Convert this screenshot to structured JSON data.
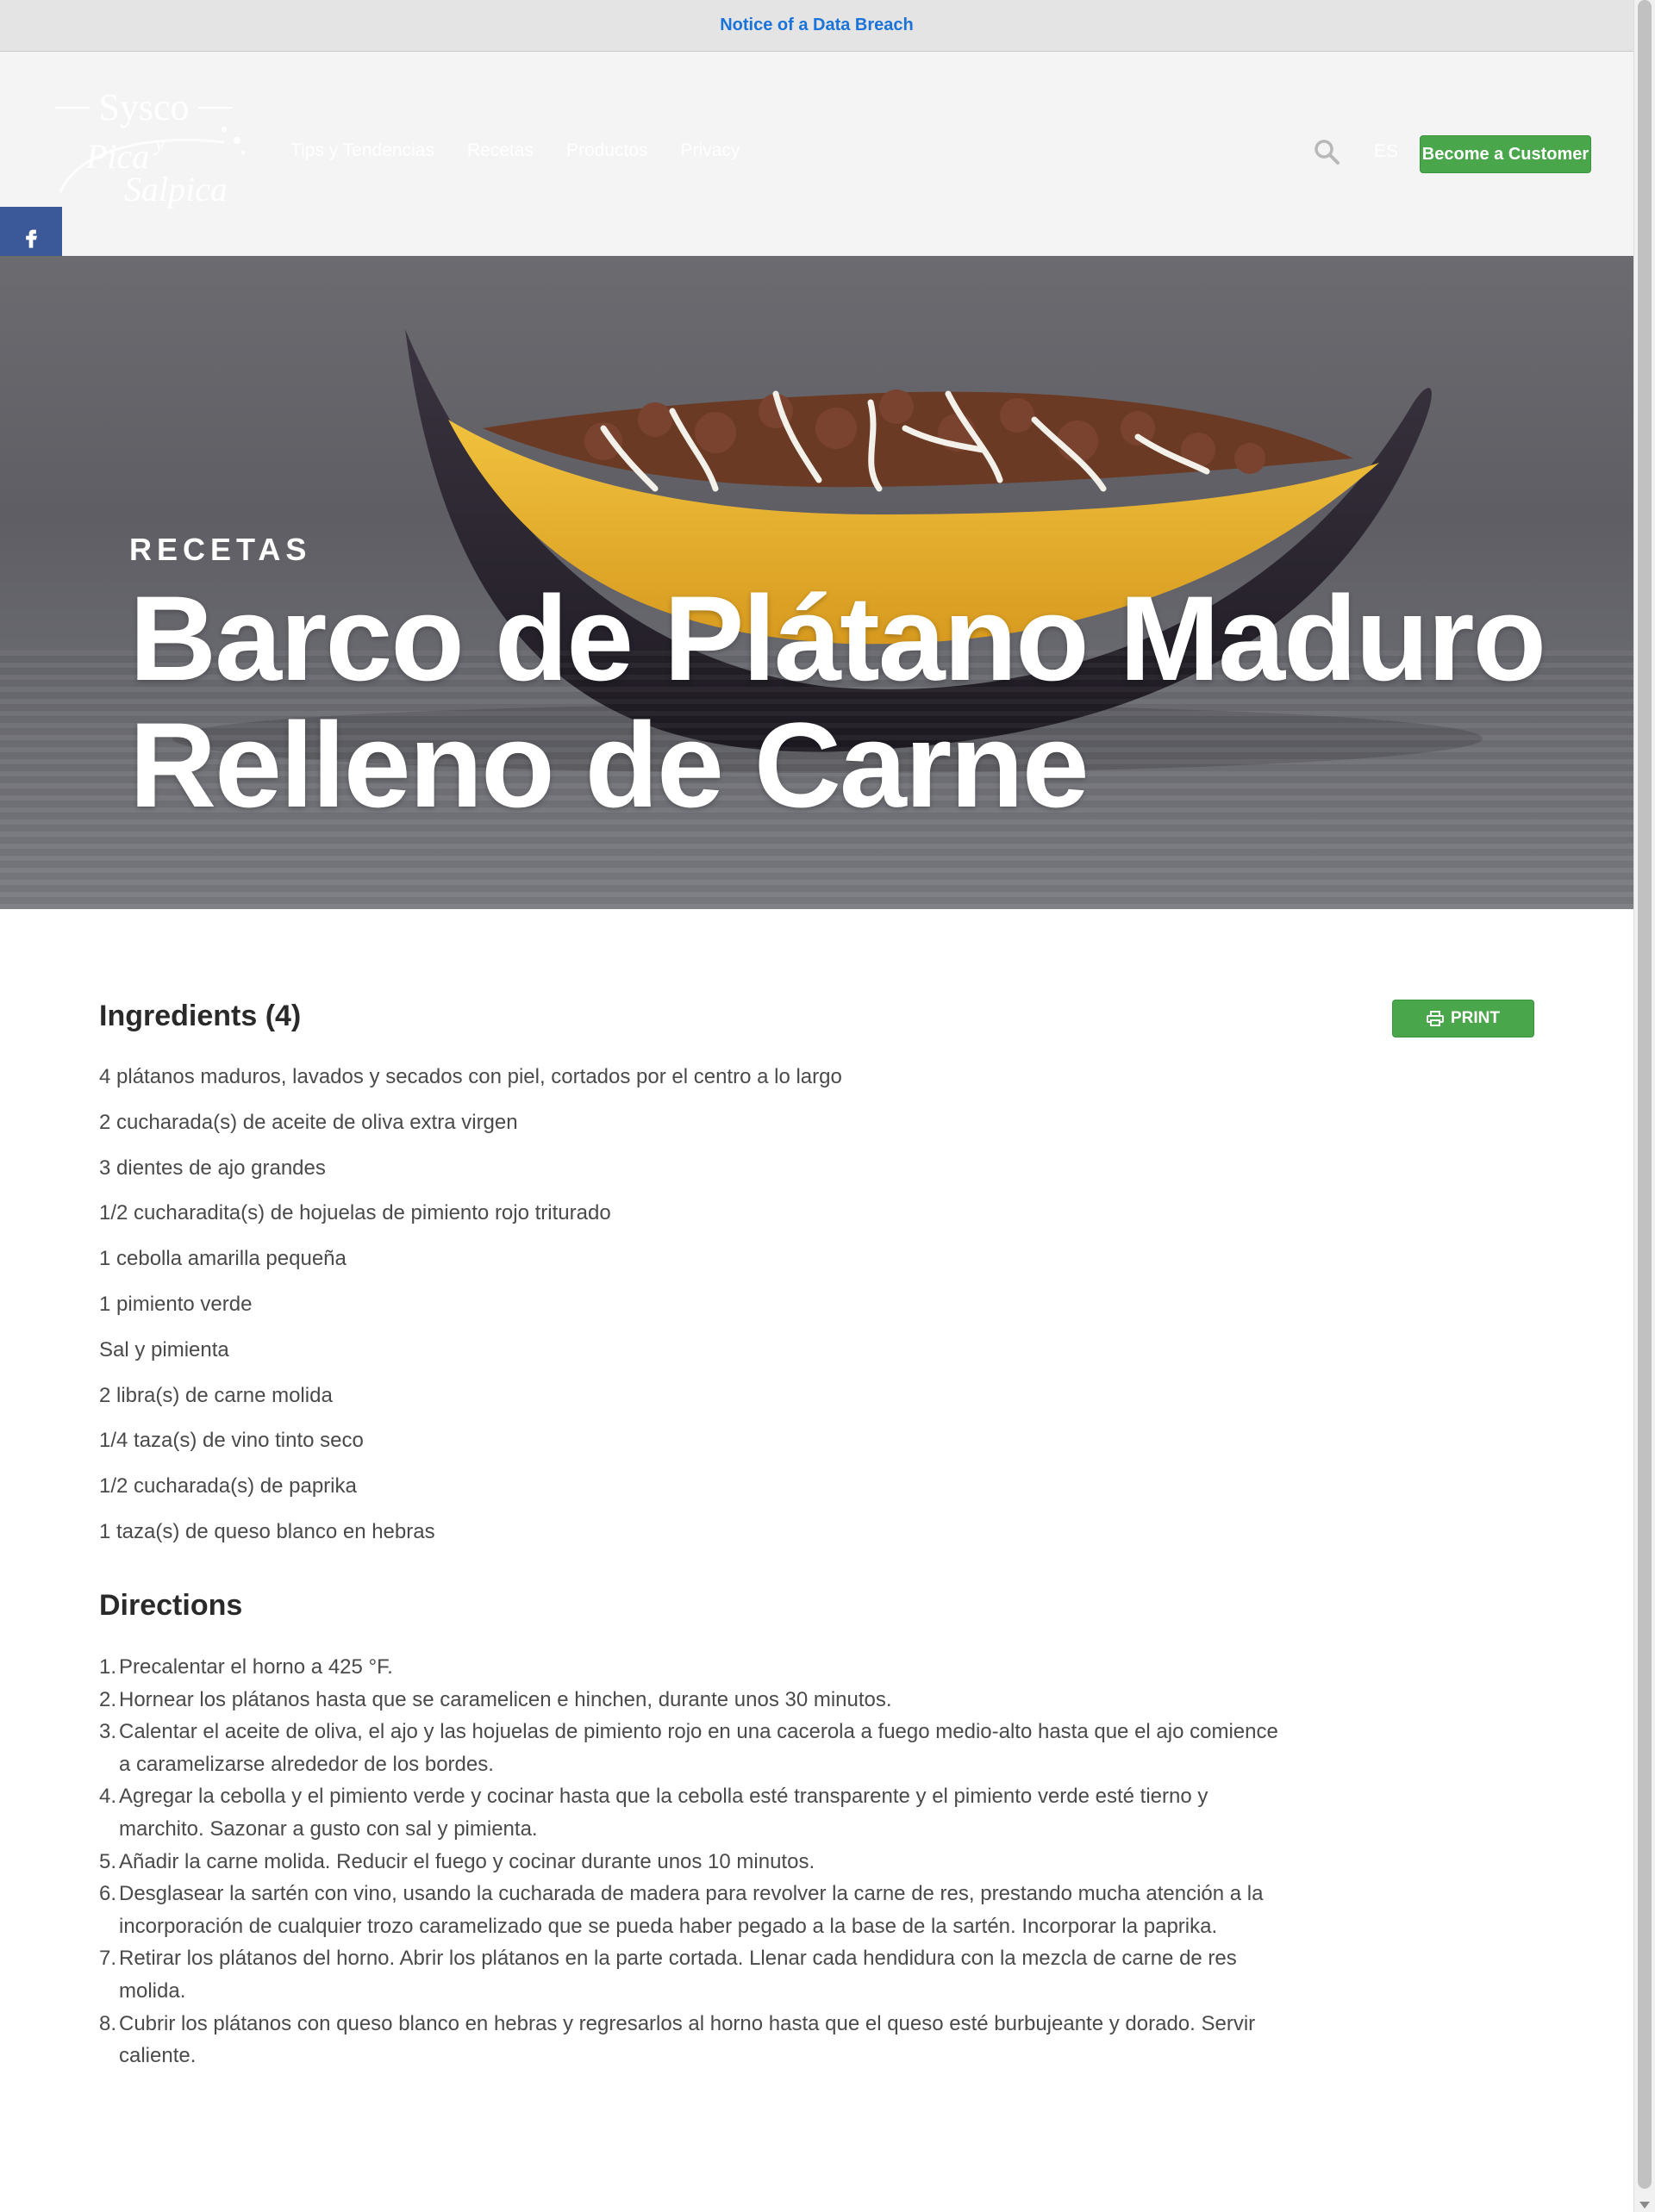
{
  "notice": {
    "text": "Notice of a Data Breach"
  },
  "header": {
    "nav": [
      "Tips y Tendencias",
      "Recetas",
      "Productos",
      "Privacy"
    ],
    "lang": "ES",
    "cta": "Become a Customer",
    "logo_icon": "sysco-pica-y-salpica-logo"
  },
  "social": [
    "facebook-icon",
    "x-icon",
    "pinterest-icon",
    "email-icon",
    "share-icon"
  ],
  "hero": {
    "label": "RECETAS",
    "title": "Barco de Plátano Maduro Relleno de Carne"
  },
  "ingredients": {
    "heading": "Ingredients (4)",
    "print": "PRINT",
    "items": [
      "4 plátanos maduros, lavados y secados con piel, cortados por el centro a lo largo",
      "2 cucharada(s) de aceite de oliva extra virgen",
      "3 dientes de ajo grandes",
      "1/2 cucharadita(s) de hojuelas de pimiento rojo triturado",
      "1 cebolla amarilla pequeña",
      "1 pimiento verde",
      "Sal y pimienta",
      "2 libra(s) de carne molida",
      "1/4 taza(s) de vino tinto seco",
      "1/2 cucharada(s) de paprika",
      "1 taza(s) de queso blanco en hebras"
    ]
  },
  "directions": {
    "heading": "Directions",
    "steps": [
      "Precalentar el horno a 425 °F.",
      "Hornear los plátanos hasta que se caramelicen e hinchen, durante unos 30 minutos.",
      "Calentar el aceite de oliva, el ajo y las hojuelas de pimiento rojo en una cacerola a fuego medio-alto hasta que el ajo comience a caramelizarse alrededor de los bordes.",
      "Agregar la cebolla y el pimiento verde y cocinar hasta que la cebolla esté transparente y el pimiento verde esté tierno y marchito. Sazonar a gusto con sal y pimienta.",
      "Añadir la carne molida. Reducir el fuego y cocinar durante unos 10 minutos.",
      "Desglasear la sartén con vino, usando la cucharada de madera para revolver la carne de res, prestando mucha atención a la incorporación de cualquier trozo caramelizado que se pueda haber pegado a la base de la sartén. Incorporar la paprika.",
      "Retirar los plátanos del horno. Abrir los plátanos en la parte cortada. Llenar cada hendidura con la mezcla de carne de res molida.",
      "Cubrir los plátanos con queso blanco en hebras y regresarlos al horno hasta que el queso esté burbujeante y dorado. Servir caliente."
    ]
  }
}
